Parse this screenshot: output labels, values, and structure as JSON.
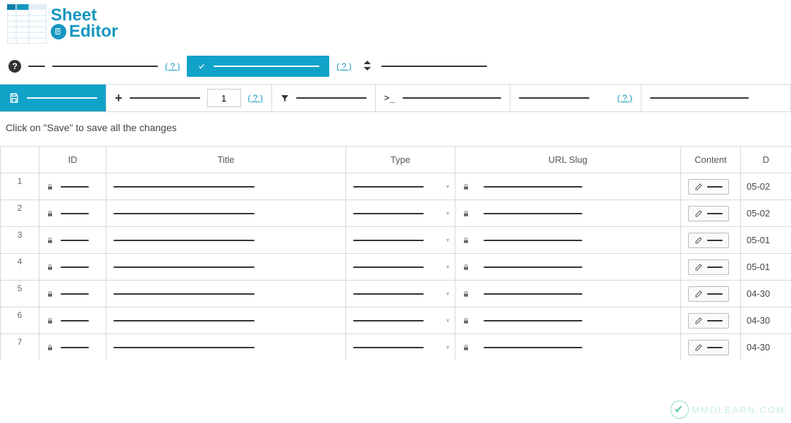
{
  "brand": {
    "line1": "Sheet",
    "line2": "Editor"
  },
  "bar1": {
    "help_q1": "( ? )",
    "help_q2": "( ? )"
  },
  "toolbar": {
    "rows_to_add": "1",
    "help_q": "( ? )",
    "help_q2": "( ? )"
  },
  "hint": "Click on \"Save\" to save all the changes",
  "columns": {
    "id": "ID",
    "title": "Title",
    "type": "Type",
    "slug": "URL Slug",
    "content": "Content",
    "date": "D"
  },
  "rows": [
    {
      "num": "1",
      "date": "05-02"
    },
    {
      "num": "2",
      "date": "05-02"
    },
    {
      "num": "3",
      "date": "05-01"
    },
    {
      "num": "4",
      "date": "05-01"
    },
    {
      "num": "5",
      "date": "04-30"
    },
    {
      "num": "6",
      "date": "04-30"
    },
    {
      "num": "7",
      "date": "04-30"
    }
  ],
  "watermark": "MMOLEARN.COM"
}
